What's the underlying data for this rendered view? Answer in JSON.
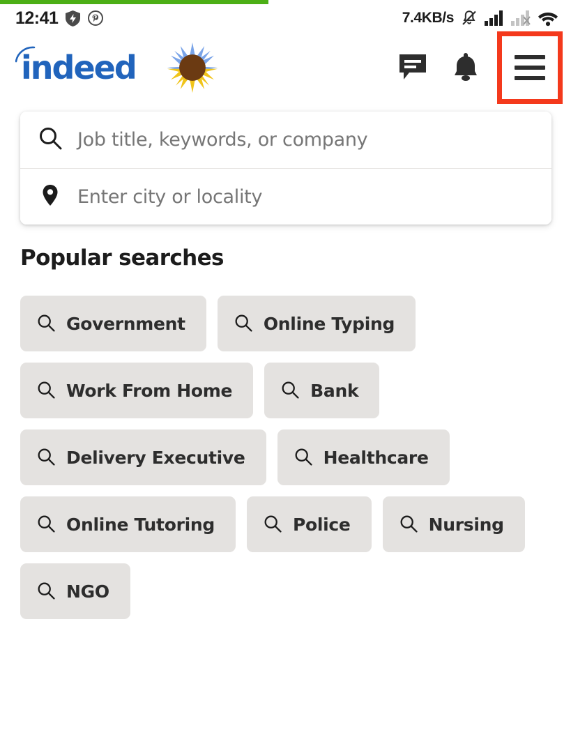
{
  "status_bar": {
    "time": "12:41",
    "left_icons": [
      "shield-bolt-icon",
      "pinterest-icon"
    ],
    "network_speed": "7.4KB/s",
    "right_icons": [
      "bell-muted-icon",
      "signal-full-icon",
      "signal-nosim-icon",
      "wifi-icon"
    ]
  },
  "progress": {
    "percent": 47,
    "color": "#4caf16"
  },
  "header": {
    "brand": "indeed",
    "brand_color": "#2164bc",
    "logo_flower": "sunflower-icon",
    "messages_icon": "message-icon",
    "notifications_icon": "bell-icon",
    "menu_icon": "hamburger-menu-icon",
    "highlight_color": "#f4391c"
  },
  "search": {
    "job_placeholder": "Job title, keywords, or company",
    "job_value": "",
    "location_placeholder": "Enter city or locality",
    "location_value": "",
    "job_icon": "search-icon",
    "location_icon": "location-pin-icon"
  },
  "popular": {
    "title": "Popular searches",
    "chip_icon": "search-icon",
    "chips": [
      {
        "label": "Government"
      },
      {
        "label": "Online Typing"
      },
      {
        "label": "Work From Home"
      },
      {
        "label": "Bank"
      },
      {
        "label": "Delivery Executive"
      },
      {
        "label": "Healthcare"
      },
      {
        "label": "Online Tutoring"
      },
      {
        "label": "Police"
      },
      {
        "label": "Nursing"
      },
      {
        "label": "NGO"
      }
    ]
  }
}
